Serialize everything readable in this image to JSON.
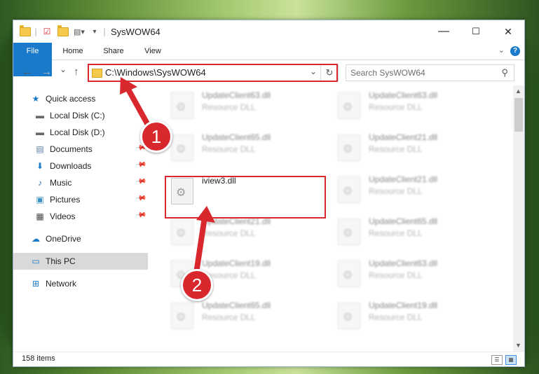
{
  "window": {
    "title": "SysWOW64",
    "controls": {
      "minimize": "—",
      "maximize": "☐",
      "close": "✕"
    }
  },
  "ribbon": {
    "tabs": [
      "File",
      "Home",
      "Share",
      "View"
    ],
    "collapse_icon": "chevron-down",
    "help_icon": "?"
  },
  "nav": {
    "back": "←",
    "forward": "→",
    "recent": "⌄",
    "up": "↑",
    "address": "C:\\Windows\\SysWOW64",
    "refresh": "↻",
    "search_placeholder": "Search SysWOW64",
    "search_icon": "⚲"
  },
  "sidebar": {
    "items": [
      {
        "label": "Quick access",
        "icon": "★"
      },
      {
        "label": "Local Disk (C:)",
        "icon": "▬"
      },
      {
        "label": "Local Disk (D:)",
        "icon": "▬"
      },
      {
        "label": "Documents",
        "icon": "▤"
      },
      {
        "label": "Downloads",
        "icon": "⬇"
      },
      {
        "label": "Music",
        "icon": "♪"
      },
      {
        "label": "Pictures",
        "icon": "▣"
      },
      {
        "label": "Videos",
        "icon": "▦"
      },
      {
        "label": "OneDrive",
        "icon": "☁"
      },
      {
        "label": "This PC",
        "icon": "▭"
      },
      {
        "label": "Network",
        "icon": "⊞"
      }
    ]
  },
  "files": [
    {
      "name": "UpdateClient63.dll",
      "type": "Resource DLL"
    },
    {
      "name": "UpdateClient63.dll",
      "type": "Resource DLL"
    },
    {
      "name": "UpdateClient65.dll",
      "type": "Resource DLL"
    },
    {
      "name": "UpdateClient21.dll",
      "type": "Resource DLL"
    },
    {
      "name": "iview3.dll",
      "type": ""
    },
    {
      "name": "UpdateClient21.dll",
      "type": "Resource DLL"
    },
    {
      "name": "UpdateClient21.dll",
      "type": "Resource DLL"
    },
    {
      "name": "UpdateClient65.dll",
      "type": "Resource DLL"
    },
    {
      "name": "UpdateClient19.dll",
      "type": "Resource DLL"
    },
    {
      "name": "UpdateClient63.dll",
      "type": "Resource DLL"
    },
    {
      "name": "UpdateClient65.dll",
      "type": "Resource DLL"
    },
    {
      "name": "UpdateClient19.dll",
      "type": "Resource DLL"
    }
  ],
  "status": {
    "count": "158 items"
  },
  "annotations": {
    "step1": "1",
    "step2": "2",
    "color": "#d9272e"
  }
}
